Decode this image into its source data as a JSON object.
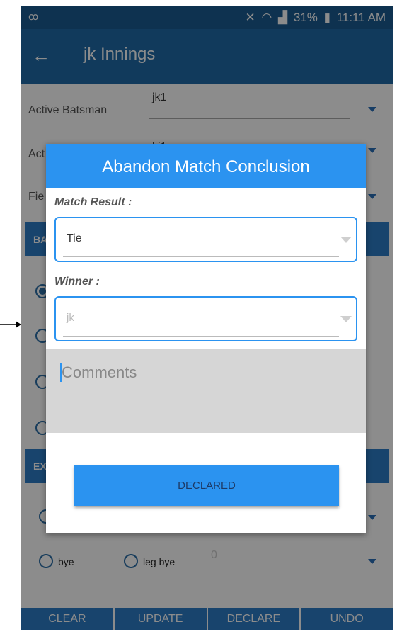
{
  "status_bar": {
    "left_icon": "voicemail-icon",
    "battery": "31%",
    "time": "11:11 AM"
  },
  "app_bar": {
    "back_icon": "arrow-back-icon",
    "title": "jk Innings"
  },
  "form": {
    "active_batsman_label": "Active Batsman",
    "active_batsman_value": "jk1",
    "row2_label_partial": "Act",
    "row2_value_partial": "ki1",
    "row3_label_partial": "Fie",
    "section1_partial": "BA",
    "section2_partial": "EX",
    "bye_label": "bye",
    "leg_bye_label": "leg bye",
    "runs_value": "0"
  },
  "bottom_buttons": [
    "CLEAR",
    "UPDATE",
    "DECLARE",
    "UNDO"
  ],
  "dialog": {
    "title": "Abandon Match Conclusion",
    "match_result_label": "Match Result :",
    "match_result_value": "Tie",
    "winner_label": "Winner :",
    "winner_value": "jk",
    "comments_placeholder": "Comments",
    "declared_label": "DECLARED"
  },
  "colors": {
    "primary": "#1f6ba8",
    "accent": "#2b93f0",
    "status": "#1a5c93"
  }
}
